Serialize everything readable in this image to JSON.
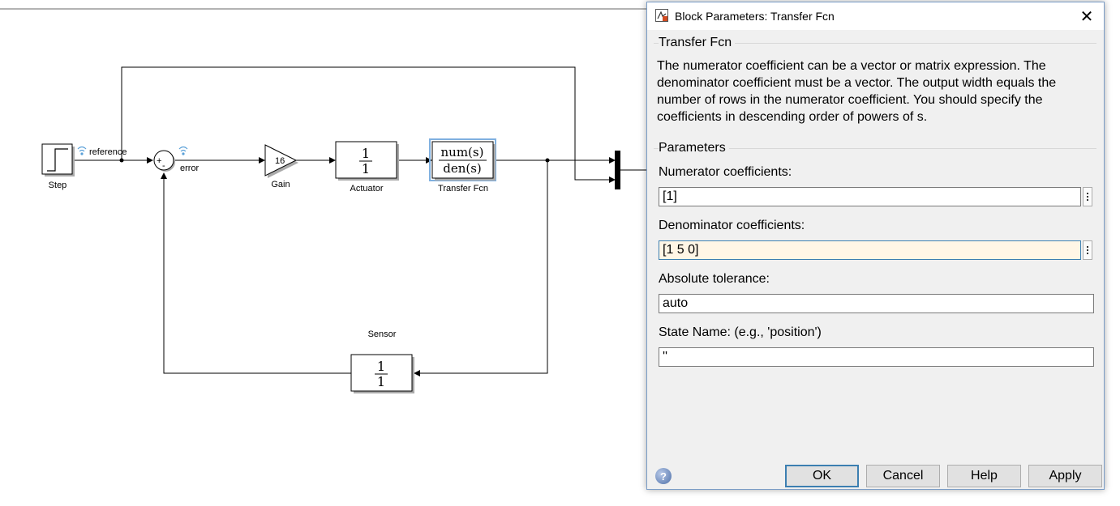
{
  "diagram": {
    "blocks": {
      "step": {
        "label": "Step"
      },
      "gain": {
        "label": "Gain",
        "value": "16"
      },
      "actuator": {
        "label": "Actuator",
        "num": "1",
        "den": "1"
      },
      "transfer_fcn": {
        "label": "Transfer Fcn",
        "num": "num(s)",
        "den": "den(s)"
      },
      "sensor": {
        "label": "Sensor",
        "num": "1",
        "den": "1"
      },
      "sum": {
        "plus": "+",
        "minus": "-"
      }
    },
    "signals": {
      "reference": "reference",
      "error": "error"
    }
  },
  "dialog": {
    "title": "Block Parameters: Transfer Fcn",
    "block_type": "Transfer Fcn",
    "description": "The numerator coefficient can be a vector or matrix expression. The denominator coefficient must be a vector. The output width equals the number of rows in the numerator coefficient. You should specify the coefficients in descending order of powers of s.",
    "parameters_title": "Parameters",
    "fields": [
      {
        "label": "Numerator coefficients:",
        "value": "[1]"
      },
      {
        "label": "Denominator coefficients:",
        "value": "[1 5 0]"
      },
      {
        "label": "Absolute tolerance:",
        "value": "auto"
      },
      {
        "label": "State Name: (e.g., 'position')",
        "value": "''"
      }
    ],
    "buttons": {
      "ok": "OK",
      "cancel": "Cancel",
      "help": "Help",
      "apply": "Apply"
    },
    "help_glyph": "?",
    "close_glyph": "✕",
    "accent_color": "#3c7fb1",
    "active_field_color": "#fff6e6"
  }
}
